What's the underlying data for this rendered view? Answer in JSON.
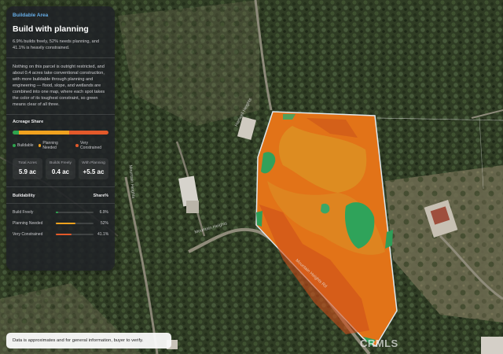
{
  "panel": {
    "eyebrow": "Buildable Area",
    "title": "Build with planning",
    "subtitle": "6.9% builds freely, 52% needs planning, and 41.1% is heavily constrained.",
    "description": "Nothing on this parcel is outright restricted, and about 0.4 acres take conventional construction, with more buildable through planning and engineering — flood, slope, and wetlands are combined into one map, where each spot takes the color of its toughest constraint, so green means clear of all three.",
    "acreage_share_label": "Acreage Share",
    "legend": [
      {
        "label": "Buildable",
        "color": "#2ea44f"
      },
      {
        "label": "Planning Needed",
        "color": "#f0a21f"
      },
      {
        "label": "Very Constrained",
        "color": "#e3592a"
      }
    ],
    "stats": [
      {
        "label": "Total Acres",
        "value": "5.9 ac"
      },
      {
        "label": "Builds Freely",
        "value": "0.4 ac"
      },
      {
        "label": "With Planning",
        "value": "+5.5 ac"
      }
    ],
    "buildability": {
      "header": "Buildability",
      "share_header": "Share%",
      "rows": [
        {
          "label": "Build Freely",
          "pct": "6.9%",
          "value": 6.9,
          "color": "#2ea44f"
        },
        {
          "label": "Planning Needed",
          "pct": "52%",
          "value": 52,
          "color": "#f0a21f"
        },
        {
          "label": "Very Constrained",
          "pct": "41.1%",
          "value": 41.1,
          "color": "#e3592a"
        }
      ]
    }
  },
  "disclaimer": "Data is approximates and for general information, buyer to verify.",
  "watermark": "CRMLS",
  "streets": [
    "Mountain Heights",
    "Hartwell Heights",
    "Mountain Heights Rd",
    "Mountain Heights"
  ]
}
